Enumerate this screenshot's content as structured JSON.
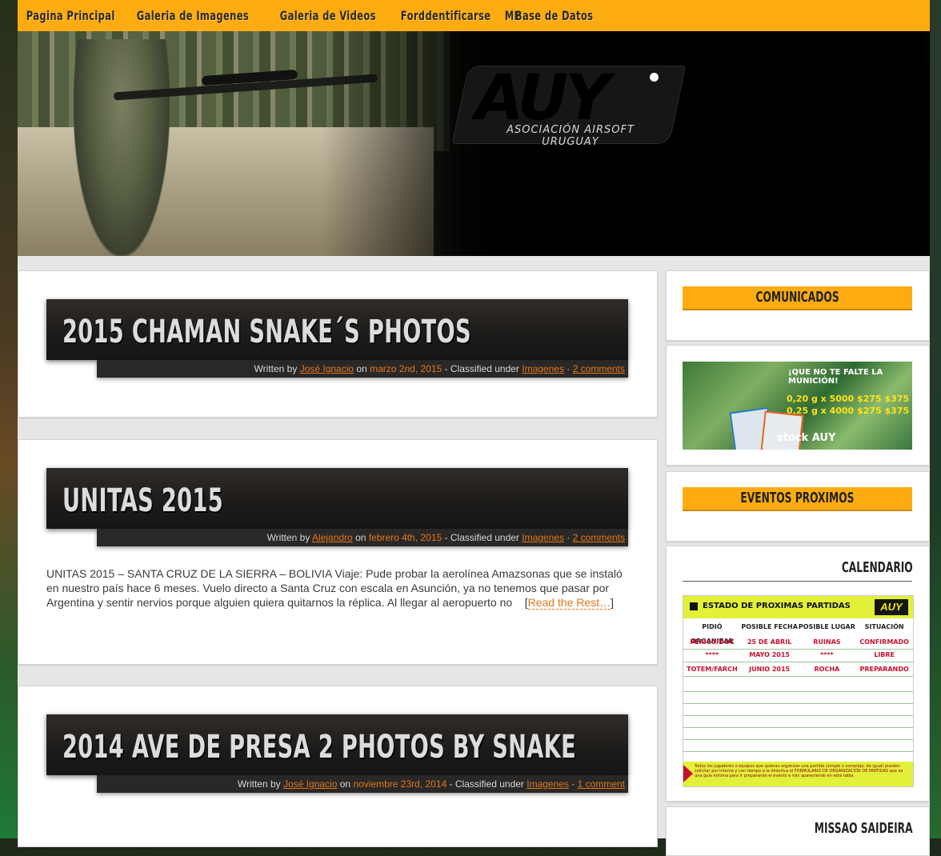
{
  "nav": {
    "items": [
      "Pagina Principal",
      "Galeria de Imagenes",
      "Galeria de Videos",
      "Foro",
      "Identificarse",
      "MP",
      "Base de Datos"
    ]
  },
  "banner": {
    "logo_mark": "AUY",
    "logo_subtitle": "ASOCIACIÓN AIRSOFT URUGUAY"
  },
  "posts": [
    {
      "title": "2015 CHAMAN SNAKE´S PHOTOS",
      "written_by": "Written by",
      "author": "José Ignacio",
      "on": "on",
      "date": "marzo 2nd, 2015",
      "classified": "- Classified under",
      "category": "Imagenes",
      "sep": "·",
      "comments": "2 comments"
    },
    {
      "title": "UNITAS 2015",
      "written_by": "Written by",
      "author": "Alejandro",
      "on": "on",
      "date": "febrero 4th, 2015",
      "classified": "- Classified under",
      "category": "Imagenes",
      "sep": "·",
      "comments": "2 comments",
      "excerpt": "UNITAS 2015 – SANTA CRUZ DE LA SIERRA – BOLIVIA Viaje: Pude probar la aerolínea Amazsonas que se instaló en nuestro país hace 6 meses. Vuelo directo a Santa Cruz con escala en Asunción, ya no tenemos que pasar por Argentina y sentir nervios porque alguien quiera quitarnos la réplica. Al llegar al aeropuerto no",
      "read_more": "Read the Rest…"
    },
    {
      "title": "2014 AVE DE PRESA 2 PHOTOS BY SNAKE",
      "written_by": "Written by",
      "author": "José Ignacio",
      "on": "on",
      "date": "noviembre 23rd, 2014",
      "classified": "- Classified under",
      "category": "Imagenes",
      "sep": "·",
      "comments": "1 comment"
    }
  ],
  "sidebar": {
    "comunicados": "COMUNICADOS",
    "ammo_ad": {
      "headline": "¡QUE NO TE FALTE LA MUNICIÓN!",
      "row1": "0,20 g x 5000  $275  $375",
      "row2": "0,25 g x 4000  $275  $375",
      "stock": "stock AUY"
    },
    "eventos": "EVENTOS PROXIMOS",
    "calendario": {
      "title": "CALENDARIO",
      "header": "ESTADO DE PROXIMAS PARTIDAS",
      "logo": "AUY",
      "columns": [
        "PIDIÓ ORGANIZAR",
        "POSIBLE FECHA",
        "POSIBLE LUGAR",
        "SITUACIÓN"
      ],
      "rows": [
        [
          "PERICO/DOC",
          "25 DE ABRIL",
          "RUINAS",
          "CONFIRMADO"
        ],
        [
          "****",
          "MAYO 2015",
          "****",
          "LIBRE"
        ],
        [
          "TOTEM/FARCH",
          "JUNIO 2015",
          "ROCHA",
          "PREPARANDO"
        ]
      ],
      "footnote": "Todos los jugadores o equipos que quieran organizar una partida (simple o compleja, da igual) pueden solicitar por interno y con tiempo a la directiva el FORMULARIO DE ORGANIZACIÓN DE PARTIDAS que es una guía mínima para ir preparando el evento e irán apareciendo en esta tabla."
    },
    "missao": "MISSAO SAIDEIRA"
  }
}
